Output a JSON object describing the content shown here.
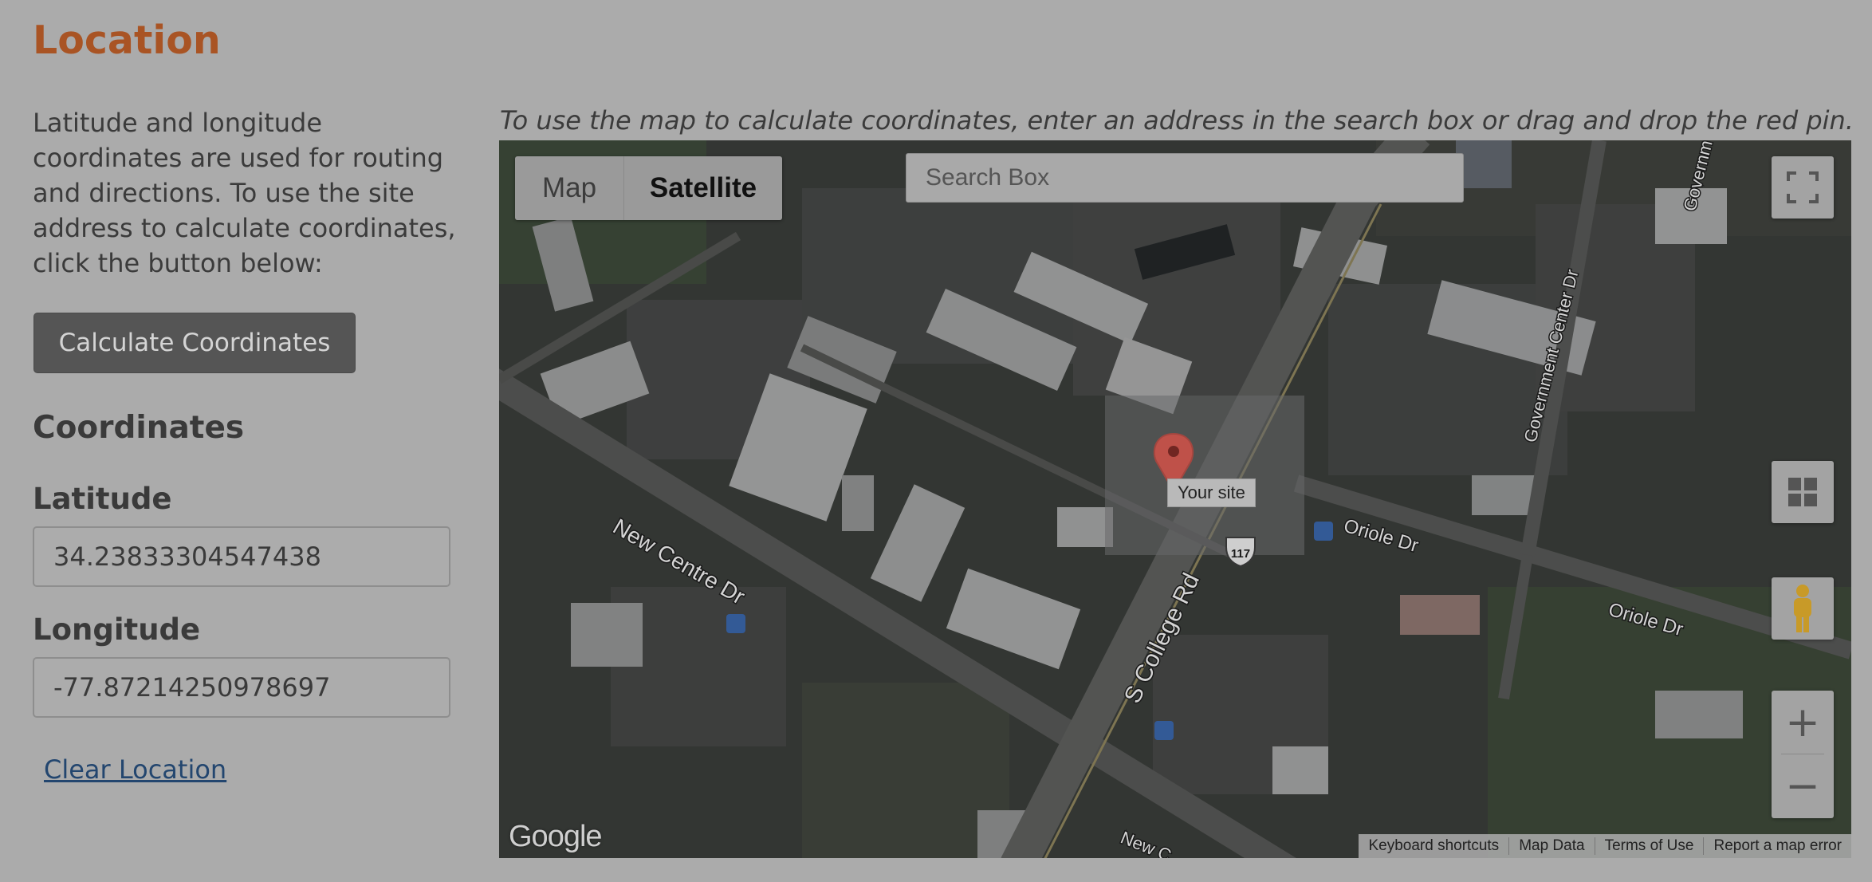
{
  "page": {
    "title": "Location",
    "description": "Latitude and longitude coordinates are used for routing and directions. To use the site address to calculate coordinates, click the button below:",
    "calculate_button": "Calculate Coordinates",
    "coordinates_heading": "Coordinates",
    "latitude_label": "Latitude",
    "latitude_value": "34.23833304547438",
    "longitude_label": "Longitude",
    "longitude_value": "-77.87214250978697",
    "clear_link": "Clear Location",
    "map_instructions": "To use the map to calculate coordinates, enter an address in the search box or drag and drop the red pin."
  },
  "map": {
    "type_map_label": "Map",
    "type_satellite_label": "Satellite",
    "selected_type": "Satellite",
    "search_placeholder": "Search Box",
    "marker_label": "Your site",
    "streets": [
      "New Centre Dr",
      "S College Rd",
      "Oriole Dr",
      "Oriole Dr",
      "Government Center Dr",
      "Governm",
      "New C"
    ],
    "route_shield": "117",
    "google_logo": "Google",
    "attribution": [
      "Keyboard shortcuts",
      "Map Data",
      "Terms of Use",
      "Report a map error"
    ],
    "zoom_in": "+",
    "zoom_out": "−",
    "icons": [
      "fullscreen-icon",
      "layers-icon",
      "pegman-icon",
      "zoom-in-icon",
      "zoom-out-icon",
      "map-marker-icon",
      "bus-stop-icon"
    ]
  },
  "colors": {
    "background": "#ababab",
    "title": "#a95424",
    "button_bg": "#555555",
    "link": "#23466f",
    "marker": "#d9534a"
  }
}
